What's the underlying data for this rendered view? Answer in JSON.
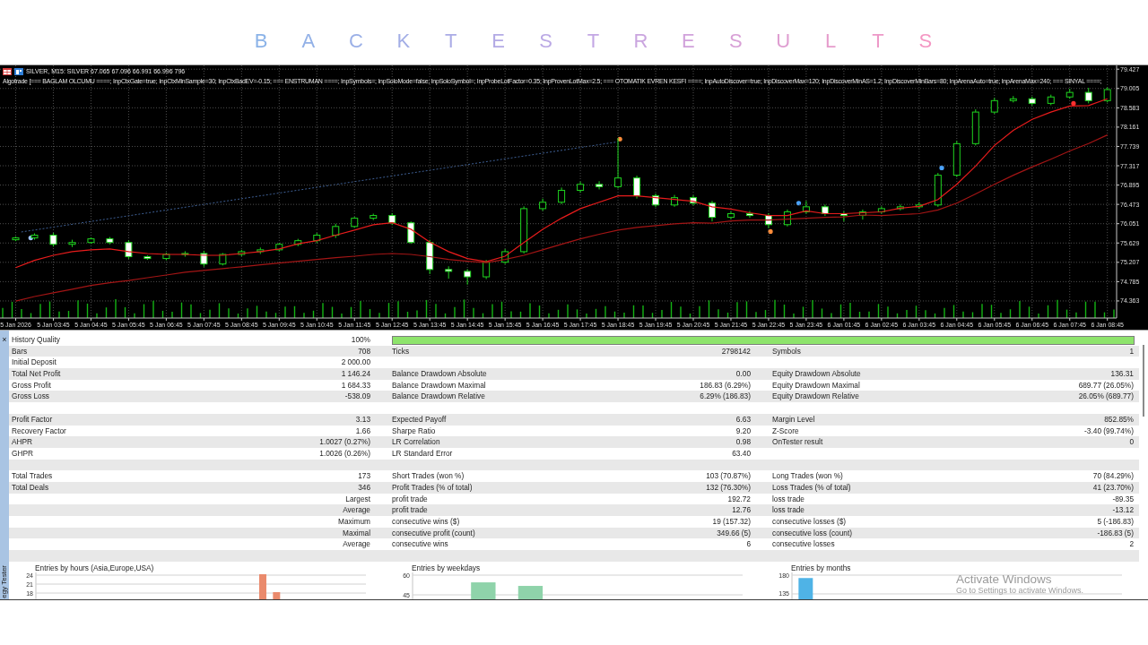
{
  "title": "B A C K T E S T R E S U L T S",
  "chart": {
    "header": {
      "symbol_line": "SILVER, M15: SILVER 67.065 67.096 66.991 66.996 796",
      "expert_line": "Algotrade [=== BAGLAM OLCUMU ====; InpCtxGate=true; InpCtxMinSample=30; InpCtxBadEV=-0.15; === ENSTRUMAN ====; InpSymbols=; InpSoloMode=false; InpSoloSymbol=; InpProbeLotFactor=0.35; InpProvenLotMax=2.5; === OTOMATIK EVREN KESFI ====; InpAutoDiscover=true; InpDiscoverMax=120; InpDiscoverMinAS=1.2; InpDiscoverMinBars=80; InpArenaAuto=true; InpArenaMax=240; === SINYAL ====;"
    },
    "chart_data": {
      "type": "candlestick",
      "grid": true,
      "ylim": [
        73.99,
        79.49
      ],
      "yticks": [
        79.427,
        79.005,
        78.583,
        78.161,
        77.739,
        77.317,
        76.895,
        76.473,
        76.051,
        75.629,
        75.207,
        74.785,
        74.363
      ],
      "categories": [
        "5 Jan 2026",
        null,
        "5 Jan 03:45",
        null,
        "5 Jan 04:45",
        null,
        "5 Jan 05:45",
        null,
        "5 Jan 06:45",
        null,
        "5 Jan 07:45",
        null,
        "5 Jan 08:45",
        null,
        "5 Jan 09:45",
        null,
        "5 Jan 10:45",
        null,
        "5 Jan 11:45",
        null,
        "5 Jan 12:45",
        null,
        "5 Jan 13:45",
        null,
        "5 Jan 14:45",
        null,
        "5 Jan 15:45",
        null,
        "5 Jan 16:45",
        null,
        "5 Jan 17:45",
        null,
        "5 Jan 18:45",
        null,
        "5 Jan 19:45",
        null,
        "5 Jan 20:45",
        null,
        "5 Jan 21:45",
        null,
        "5 Jan 22:45",
        null,
        "5 Jan 23:45",
        null,
        "6 Jan 01:45",
        null,
        "6 Jan 02:45",
        null,
        "6 Jan 03:45",
        null,
        "6 Jan 04:45",
        null,
        "6 Jan 05:45",
        null,
        "6 Jan 06:45",
        null,
        "6 Jan 07:45",
        null,
        "6 Jan 08:45"
      ],
      "ohlc": [
        [
          75.7,
          75.77,
          75.67,
          75.74
        ],
        [
          75.74,
          75.84,
          75.7,
          75.8
        ],
        [
          75.8,
          75.85,
          75.55,
          75.6
        ],
        [
          75.6,
          75.7,
          75.54,
          75.64
        ],
        [
          75.64,
          75.75,
          75.61,
          75.72
        ],
        [
          75.72,
          75.76,
          75.6,
          75.64
        ],
        [
          75.64,
          75.69,
          75.28,
          75.33
        ],
        [
          75.33,
          75.36,
          75.26,
          75.29
        ],
        [
          75.29,
          75.42,
          75.25,
          75.38
        ],
        [
          75.38,
          75.45,
          75.33,
          75.4
        ],
        [
          75.4,
          75.46,
          75.11,
          75.17
        ],
        [
          75.17,
          75.41,
          75.14,
          75.38
        ],
        [
          75.38,
          75.48,
          75.34,
          75.44
        ],
        [
          75.44,
          75.53,
          75.39,
          75.48
        ],
        [
          75.48,
          75.63,
          75.45,
          75.6
        ],
        [
          75.6,
          75.72,
          75.56,
          75.68
        ],
        [
          75.68,
          75.85,
          75.63,
          75.8
        ],
        [
          75.8,
          76.05,
          75.74,
          75.99
        ],
        [
          75.99,
          76.2,
          75.96,
          76.17
        ],
        [
          76.17,
          76.27,
          76.13,
          76.23
        ],
        [
          76.23,
          76.28,
          76.02,
          76.07
        ],
        [
          76.07,
          76.1,
          75.61,
          75.64
        ],
        [
          75.64,
          75.7,
          74.95,
          75.05
        ],
        [
          75.05,
          75.12,
          74.85,
          75.01
        ],
        [
          75.01,
          75.06,
          74.72,
          74.89
        ],
        [
          74.89,
          75.26,
          74.84,
          75.21
        ],
        [
          75.21,
          75.5,
          75.17,
          75.44
        ],
        [
          75.44,
          76.43,
          75.4,
          76.38
        ],
        [
          76.38,
          76.6,
          76.33,
          76.52
        ],
        [
          76.52,
          76.84,
          76.48,
          76.78
        ],
        [
          76.78,
          76.97,
          76.73,
          76.91
        ],
        [
          76.91,
          76.98,
          76.8,
          76.86
        ],
        [
          76.86,
          77.92,
          76.82,
          77.05
        ],
        [
          77.05,
          77.1,
          76.6,
          76.66
        ],
        [
          76.66,
          76.71,
          76.41,
          76.46
        ],
        [
          76.46,
          76.68,
          76.42,
          76.62
        ],
        [
          76.62,
          76.67,
          76.45,
          76.5
        ],
        [
          76.5,
          76.55,
          76.1,
          76.19
        ],
        [
          76.19,
          76.32,
          76.15,
          76.27
        ],
        [
          76.27,
          76.33,
          76.18,
          76.23
        ],
        [
          76.23,
          76.28,
          75.95,
          76.03
        ],
        [
          76.03,
          76.36,
          75.99,
          76.31
        ],
        [
          76.31,
          76.55,
          76.27,
          76.42
        ],
        [
          76.42,
          76.47,
          76.22,
          76.27
        ],
        [
          76.27,
          76.32,
          76.1,
          76.23
        ],
        [
          76.23,
          76.36,
          76.14,
          76.31
        ],
        [
          76.31,
          76.43,
          76.27,
          76.38
        ],
        [
          76.38,
          76.47,
          76.34,
          76.42
        ],
        [
          76.42,
          76.52,
          76.38,
          76.46
        ],
        [
          76.46,
          77.16,
          76.42,
          77.11
        ],
        [
          77.11,
          77.86,
          77.07,
          77.8
        ],
        [
          77.8,
          78.55,
          77.76,
          78.49
        ],
        [
          78.49,
          78.8,
          78.45,
          78.74
        ],
        [
          78.74,
          78.84,
          78.7,
          78.78
        ],
        [
          78.78,
          78.83,
          78.63,
          78.68
        ],
        [
          78.68,
          78.87,
          78.64,
          78.82
        ],
        [
          78.82,
          79.0,
          78.78,
          78.92
        ],
        [
          78.92,
          79.02,
          78.68,
          78.74
        ],
        [
          78.74,
          79.03,
          78.7,
          78.98
        ]
      ],
      "series": [
        {
          "type": "line",
          "color": "#e81c1c",
          "values": [
            75.09,
            75.25,
            75.36,
            75.44,
            75.48,
            75.5,
            75.44,
            75.4,
            75.38,
            75.38,
            75.36,
            75.36,
            75.4,
            75.44,
            75.5,
            75.61,
            75.68,
            75.8,
            75.91,
            76.03,
            76.07,
            75.93,
            75.65,
            75.44,
            75.29,
            75.22,
            75.34,
            75.64,
            75.93,
            76.17,
            76.38,
            76.52,
            76.66,
            76.66,
            76.62,
            76.58,
            76.54,
            76.42,
            76.37,
            76.29,
            76.23,
            76.23,
            76.33,
            76.27,
            76.27,
            76.29,
            76.31,
            76.39,
            76.43,
            76.58,
            76.91,
            77.31,
            77.76,
            78.09,
            78.33,
            78.49,
            78.62,
            78.63,
            78.78
          ]
        },
        {
          "type": "line",
          "color": "#a31515",
          "values": [
            74.36,
            74.46,
            74.54,
            74.62,
            74.7,
            74.76,
            74.81,
            74.87,
            74.93,
            74.99,
            75.03,
            75.07,
            75.11,
            75.15,
            75.19,
            75.23,
            75.27,
            75.31,
            75.34,
            75.38,
            75.4,
            75.38,
            75.33,
            75.27,
            75.23,
            75.2,
            75.27,
            75.36,
            75.48,
            75.6,
            75.72,
            75.82,
            75.91,
            75.97,
            76.01,
            76.05,
            76.07,
            76.06,
            76.11,
            76.13,
            76.13,
            76.15,
            76.17,
            76.19,
            76.2,
            76.24,
            76.23,
            76.25,
            76.27,
            76.35,
            76.5,
            76.7,
            76.91,
            77.11,
            77.29,
            77.46,
            77.64,
            77.8,
            77.99
          ]
        }
      ]
    }
  },
  "stats": {
    "close": "×",
    "rows": [
      {
        "kind": "quality",
        "left": {
          "label": "History Quality",
          "value": "100%"
        },
        "level": 1
      },
      {
        "kind": "stats",
        "left": {
          "label": "Bars",
          "value": "708"
        },
        "middle": {
          "label": "Ticks",
          "value": "2798142"
        },
        "right": {
          "label": "Symbols",
          "value": "1"
        }
      },
      {
        "kind": "stats",
        "left": {
          "label": "Initial Deposit",
          "value": "2 000.00"
        }
      },
      {
        "kind": "stats",
        "left": {
          "label": "Total Net Profit",
          "value": "1 146.24"
        },
        "middle": {
          "label": "Balance Drawdown Absolute",
          "value": "0.00"
        },
        "right": {
          "label": "Equity Drawdown Absolute",
          "value": "136.31"
        }
      },
      {
        "kind": "stats",
        "left": {
          "label": "Gross Profit",
          "value": "1 684.33"
        },
        "middle": {
          "label": "Balance Drawdown Maximal",
          "value": "186.83 (6.29%)"
        },
        "right": {
          "label": "Equity Drawdown Maximal",
          "value": "689.77 (26.05%)"
        }
      },
      {
        "kind": "stats",
        "left": {
          "label": "Gross Loss",
          "value": "-538.09"
        },
        "middle": {
          "label": "Balance Drawdown Relative",
          "value": "6.29% (186.83)"
        },
        "right": {
          "label": "Equity Drawdown Relative",
          "value": "26.05% (689.77)"
        }
      },
      {
        "kind": "blank"
      },
      {
        "kind": "stats",
        "left": {
          "label": "Profit Factor",
          "value": "3.13"
        },
        "middle": {
          "label": "Expected Payoff",
          "value": "6.63"
        },
        "right": {
          "label": "Margin Level",
          "value": "852.85%"
        }
      },
      {
        "kind": "stats",
        "left": {
          "label": "Recovery Factor",
          "value": "1.66"
        },
        "middle": {
          "label": "Sharpe Ratio",
          "value": "9.20"
        },
        "right": {
          "label": "Z-Score",
          "value": "-3.40 (99.74%)"
        }
      },
      {
        "kind": "stats",
        "left": {
          "label": "AHPR",
          "value": "1.0027 (0.27%)"
        },
        "middle": {
          "label": "LR Correlation",
          "value": "0.98"
        },
        "right": {
          "label": "OnTester result",
          "value": "0"
        }
      },
      {
        "kind": "stats",
        "left": {
          "label": "GHPR",
          "value": "1.0026 (0.26%)"
        },
        "middle": {
          "label": "LR Standard Error",
          "value": "63.40"
        }
      },
      {
        "kind": "blank"
      },
      {
        "kind": "stats",
        "left": {
          "label": "Total Trades",
          "value": "173"
        },
        "middle": {
          "label": "Short Trades (won %)",
          "value": "103 (70.87%)"
        },
        "right": {
          "label": "Long Trades (won %)",
          "value": "70 (84.29%)"
        }
      },
      {
        "kind": "stats",
        "left": {
          "label": "Total Deals",
          "value": "346"
        },
        "middle": {
          "label": "Profit Trades (% of total)",
          "value": "132 (76.30%)"
        },
        "right": {
          "label": "Loss Trades (% of total)",
          "value": "41 (23.70%)"
        }
      },
      {
        "kind": "group",
        "caption": "Largest",
        "middle": {
          "label": "profit trade",
          "value": "192.72"
        },
        "right": {
          "label": "loss trade",
          "value": "-89.35"
        }
      },
      {
        "kind": "group",
        "caption": "Average",
        "middle": {
          "label": "profit trade",
          "value": "12.76"
        },
        "right": {
          "label": "loss trade",
          "value": "-13.12"
        }
      },
      {
        "kind": "group",
        "caption": "Maximum",
        "middle": {
          "label": "consecutive wins ($)",
          "value": "19 (157.32)"
        },
        "right": {
          "label": "consecutive losses ($)",
          "value": "5 (-186.83)"
        }
      },
      {
        "kind": "group",
        "caption": "Maximal",
        "middle": {
          "label": "consecutive profit (count)",
          "value": "349.66 (5)"
        },
        "right": {
          "label": "consecutive loss (count)",
          "value": "-186.83 (5)"
        }
      },
      {
        "kind": "group",
        "caption": "Average",
        "middle": {
          "label": "consecutive wins",
          "value": "6"
        },
        "right": {
          "label": "consecutive losses",
          "value": "2"
        }
      },
      {
        "kind": "blank"
      }
    ]
  },
  "distributions": [
    {
      "chart_data": {
        "type": "bar",
        "title": "Entries by hours (Asia,Europe,USA)",
        "grid": true,
        "yticks": [
          18,
          21,
          24
        ],
        "ylim": [
          15.9,
          24.9
        ],
        "series": [
          {
            "color": "#ea8a6c",
            "values": [
              null,
              null,
              null,
              null,
              null,
              null,
              null,
              null,
              null,
              null,
              null,
              null,
              null,
              null,
              null,
              null,
              24.3,
              18.3,
              null,
              null,
              null,
              null,
              null,
              null
            ]
          }
        ]
      }
    },
    {
      "chart_data": {
        "type": "bar",
        "title": "Entries by weekdays",
        "grid": true,
        "yticks": [
          45,
          60
        ],
        "ylim": [
          41.6,
          62.05
        ],
        "series": [
          {
            "color": "#8fd3aa",
            "values": [
              null,
              54.5,
              51.8,
              null,
              null,
              null,
              null
            ]
          }
        ]
      }
    },
    {
      "chart_data": {
        "type": "bar",
        "title": "Entries by months",
        "grid": true,
        "yticks": [
          135,
          180
        ],
        "ylim": [
          122.1,
          186.4
        ],
        "series": [
          {
            "color": "#4fb3e6",
            "values": [
              173,
              null,
              null,
              null,
              null,
              null,
              null,
              null,
              null,
              null,
              null,
              null
            ]
          }
        ]
      }
    }
  ],
  "side_tab": {
    "label": "egy Tester"
  },
  "os_notice": {
    "title": "Activate Windows",
    "text": "Go to Settings to activate Windows."
  }
}
